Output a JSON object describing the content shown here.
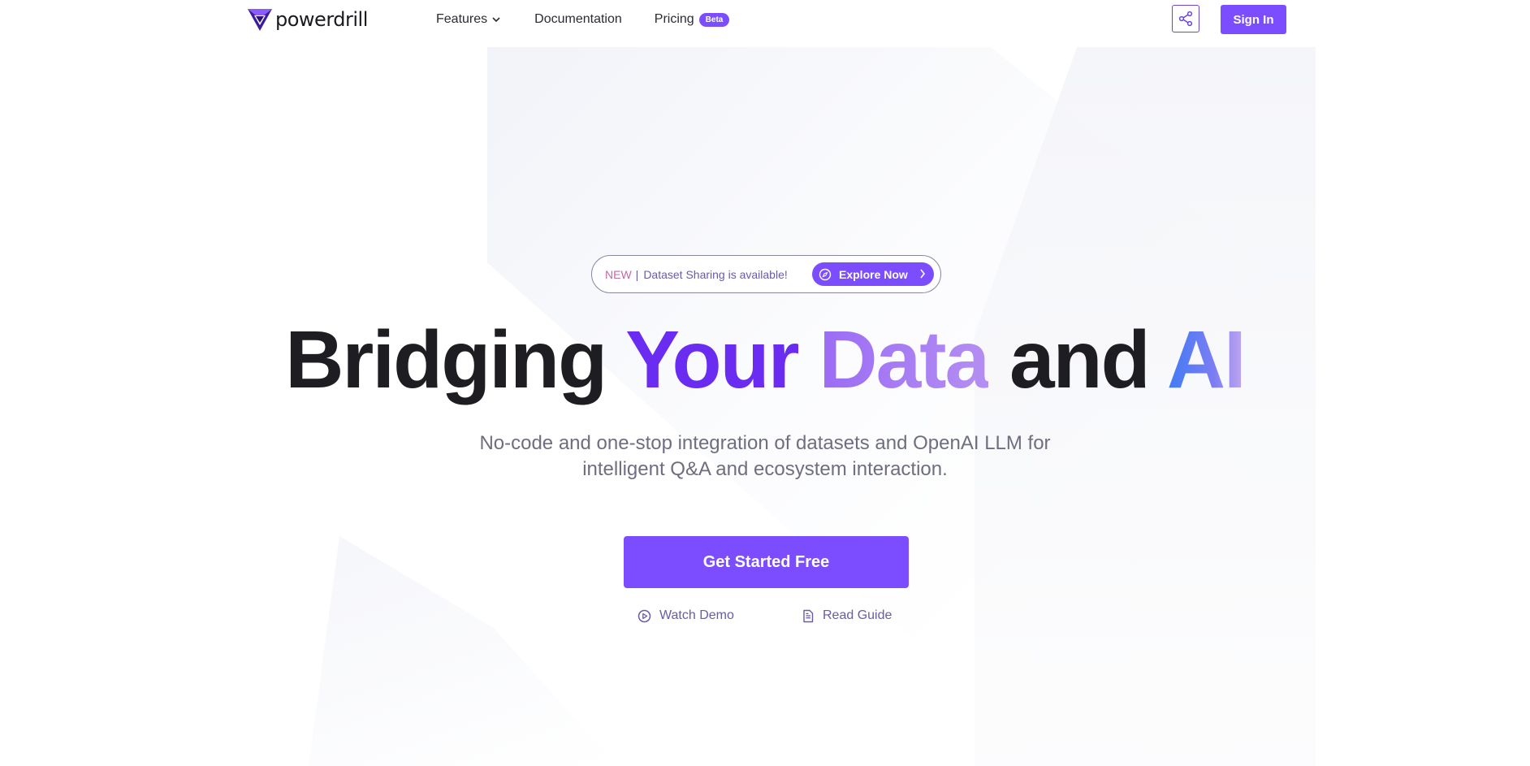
{
  "header": {
    "logo_text": "powerdrill",
    "nav": {
      "features": "Features",
      "documentation": "Documentation",
      "pricing": "Pricing",
      "pricing_badge": "Beta"
    },
    "share_icon": "share-icon",
    "sign_in": "Sign In"
  },
  "announcement": {
    "new_label": "NEW",
    "separator": "|",
    "text": "Dataset Sharing is available!",
    "button_label": "Explore Now",
    "button_icon": "compass-icon",
    "arrow_icon": "chevron-right-icon"
  },
  "hero": {
    "headline": {
      "word1": "Bridging",
      "word2": "Your",
      "word3": "Data",
      "word4": "and",
      "word5": "AI"
    },
    "subtitle_line1": "No-code and one-stop integration of datasets and OpenAI LLM for",
    "subtitle_line2": "intelligent Q&A and ecosystem interaction.",
    "cta_label": "Get Started Free",
    "watch_demo": "Watch Demo",
    "read_guide": "Read Guide"
  },
  "colors": {
    "brand": "#7c4dff",
    "your": "#6a2cf0",
    "data_gradient": [
      "#9b6cf4",
      "#b48ef3"
    ],
    "ai_gradient": [
      "#3f7cf5",
      "#c7a7f0"
    ],
    "headline_dark": "#1e1e22",
    "subtitle": "#6e6e80"
  }
}
